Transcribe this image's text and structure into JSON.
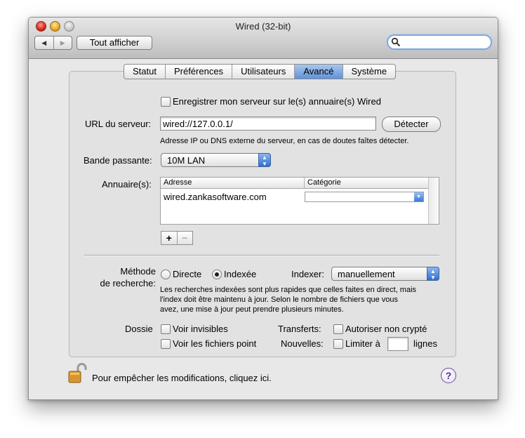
{
  "window": {
    "title": "Wired (32-bit)"
  },
  "toolbar": {
    "back_glyph": "◀",
    "forward_glyph": "▶",
    "show_all_label": "Tout afficher",
    "search_value": ""
  },
  "tabs": [
    {
      "label": "Statut",
      "active": false
    },
    {
      "label": "Préférences",
      "active": false
    },
    {
      "label": "Utilisateurs",
      "active": false
    },
    {
      "label": "Avancé",
      "active": true
    },
    {
      "label": "Système",
      "active": false
    }
  ],
  "register": {
    "label": "Enregistrer mon serveur sur le(s) annuaire(s) Wired",
    "checked": false
  },
  "server_url": {
    "label": "URL du serveur:",
    "value": "wired://127.0.0.1/",
    "detect_label": "Détecter",
    "hint": "Adresse IP ou DNS externe du serveur, en cas de doutes faîtes détecter."
  },
  "bandwidth": {
    "label": "Bande passante:",
    "value": "10M LAN"
  },
  "trackers": {
    "label": "Annuaire(s):",
    "columns": [
      "Adresse",
      "Catégorie"
    ],
    "rows": [
      {
        "address": "wired.zankasoftware.com",
        "category": ""
      }
    ],
    "add_label": "+",
    "remove_label": "−"
  },
  "search_method": {
    "label_line1": "Méthode",
    "label_line2": "de recherche:",
    "option_direct": "Directe",
    "option_indexed": "Indexée",
    "selected": "Indexée",
    "indexer_label": "Indexer:",
    "indexer_value": "manuellement",
    "description_line1": "Les recherches indexées sont plus rapides que celles faites en direct, mais",
    "description_line2": "l'index doit être maintenu à jour. Selon le nombre de fichiers que vous",
    "description_line3": "avez, une mise à jour peut prendre plusieurs minutes."
  },
  "files": {
    "label": "Dossie",
    "show_invisible": "Voir invisibles",
    "show_dot_files": "Voir les fichiers point"
  },
  "transfers": {
    "label": "Transferts:",
    "allow_unencrypted": "Autoriser non crypté"
  },
  "news": {
    "label": "Nouvelles:",
    "limit_label": "Limiter à",
    "limit_value": "",
    "limit_unit": "lignes"
  },
  "footer": {
    "lock_text": "Pour empêcher les modifications, cliquez ici.",
    "help_glyph": "?"
  }
}
